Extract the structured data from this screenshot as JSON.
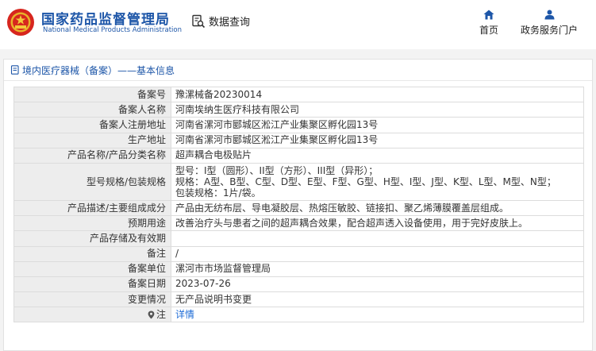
{
  "header": {
    "brand_cn": "国家药品监督管理局",
    "brand_en": "National Medical Products Administration",
    "query_label": "数据查询",
    "nav_home": "首页",
    "nav_portal": "政务服务门户"
  },
  "panel": {
    "title": "境内医疗器械（备案）——基本信息"
  },
  "rows": [
    {
      "label": "备案号",
      "value": "豫漯械备20230014"
    },
    {
      "label": "备案人名称",
      "value": "河南埃纳生医疗科技有限公司"
    },
    {
      "label": "备案人注册地址",
      "value": "河南省漯河市郾城区淞江产业集聚区孵化园13号"
    },
    {
      "label": "生产地址",
      "value": "河南省漯河市郾城区淞江产业集聚区孵化园13号"
    },
    {
      "label": "产品名称/产品分类名称",
      "value": "超声耦合电极贴片"
    },
    {
      "label": "型号规格/包装规格",
      "lines": [
        "型号：I型（圆形）、II型（方形）、III型（异形）；",
        "规格：A型、B型、C型、D型、E型、F型、G型、H型、I型、J型、K型、L型、M型、N型；",
        "包装规格：1片/袋。"
      ]
    },
    {
      "label": "产品描述/主要组成成分",
      "value": "产品由无纺布层、导电凝胶层、热熔压敏胶、链接扣、聚乙烯薄膜覆盖层组成。"
    },
    {
      "label": "预期用途",
      "value": "改善治疗头与患者之间的超声耦合效果，配合超声透入设备使用，用于完好皮肤上。"
    },
    {
      "label": "产品存储及有效期",
      "value": ""
    },
    {
      "label": "备注",
      "value": "/"
    },
    {
      "label": "备案单位",
      "value": "漯河市市场监督管理局"
    },
    {
      "label": "备案日期",
      "value": "2023-07-26"
    },
    {
      "label": "变更情况",
      "value": "无产品说明书变更"
    },
    {
      "label": "注",
      "value": "详情"
    }
  ],
  "colors": {
    "brand": "#1d56a8",
    "link": "#1d6bd6",
    "label_bg": "#ededed"
  }
}
